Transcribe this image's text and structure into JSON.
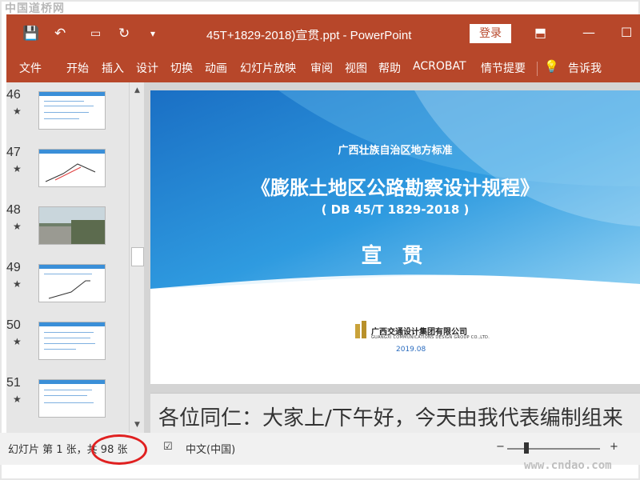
{
  "watermark_top": "中国道桥网",
  "watermark_bottom": "www.cndao.com",
  "titlebar": {
    "title": "45T+1829-2018)宣贯.ppt  -  PowerPoint",
    "login_label": "登录",
    "quick_access": {
      "save": "💾",
      "undo": "↶",
      "more": "▾"
    }
  },
  "ribbon_tabs": [
    "文件",
    "开始",
    "插入",
    "设计",
    "切换",
    "动画",
    "幻灯片放映",
    "审阅",
    "视图",
    "帮助",
    "ACROBAT",
    "情节提要",
    "告诉我"
  ],
  "thumbnails": [
    {
      "number": "46",
      "star": "★"
    },
    {
      "number": "47",
      "star": "★"
    },
    {
      "number": "48",
      "star": "★"
    },
    {
      "number": "49",
      "star": "★"
    },
    {
      "number": "50",
      "star": "★"
    },
    {
      "number": "51",
      "star": "★"
    }
  ],
  "slide": {
    "line1": "广西壮族自治区地方标准",
    "title": "《膨胀土地区公路勘察设计规程》",
    "code": "( DB 45/T 1829-2018 )",
    "big": "宣 贯",
    "company_cn": "广西交通设计集团有限公司",
    "company_en": "GUANGXI COMMUNICATIONS DESIGN GROUP CO.,LTD.",
    "date": "2019.08"
  },
  "notes_text": "各位同仁：大家上/下午好，今天由我代表编制组来",
  "status": {
    "slide_info": "幻灯片 第 1 张，共 98 张",
    "language": "中文(中国)",
    "zoom_minus": "−",
    "zoom_plus": "+"
  },
  "colors": {
    "accent": "#b7472a",
    "slide_blue": "#1e88d8",
    "annotation_ring": "#e02020"
  }
}
